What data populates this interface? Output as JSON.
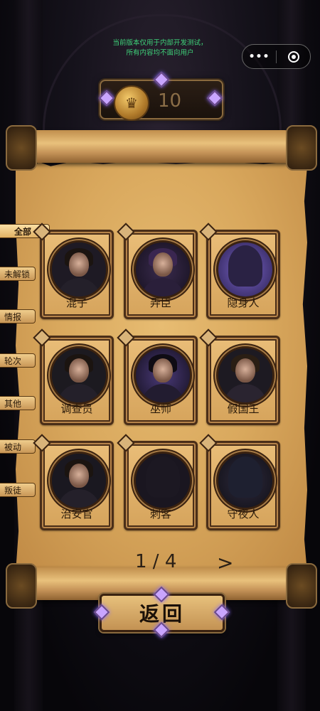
{
  "notice": {
    "line1": "当前版本仅用于内部开发测试，",
    "line2": "所有内容均不面向用户"
  },
  "capsule": {
    "more": "•••"
  },
  "currency": {
    "value": "10",
    "icon": "coin-icon"
  },
  "tabs": [
    {
      "label": "全部",
      "active": true
    },
    {
      "label": "未解锁",
      "active": false
    },
    {
      "label": "情报",
      "active": false
    },
    {
      "label": "轮次",
      "active": false
    },
    {
      "label": "其他",
      "active": false
    },
    {
      "label": "被动",
      "active": false
    },
    {
      "label": "叛徒",
      "active": false
    }
  ],
  "cards": [
    {
      "name": "混子"
    },
    {
      "name": "弄臣"
    },
    {
      "name": "隐身人"
    },
    {
      "name": "调查员"
    },
    {
      "name": "巫师"
    },
    {
      "name": "假国王"
    },
    {
      "name": "治安官"
    },
    {
      "name": "刺客"
    },
    {
      "name": "守夜人"
    }
  ],
  "pager": {
    "text": "1 / 4",
    "next": ">"
  },
  "back_button": "返回",
  "colors": {
    "accent": "#e1b164",
    "notice": "#3fd37a",
    "frame": "#4a2e18"
  }
}
